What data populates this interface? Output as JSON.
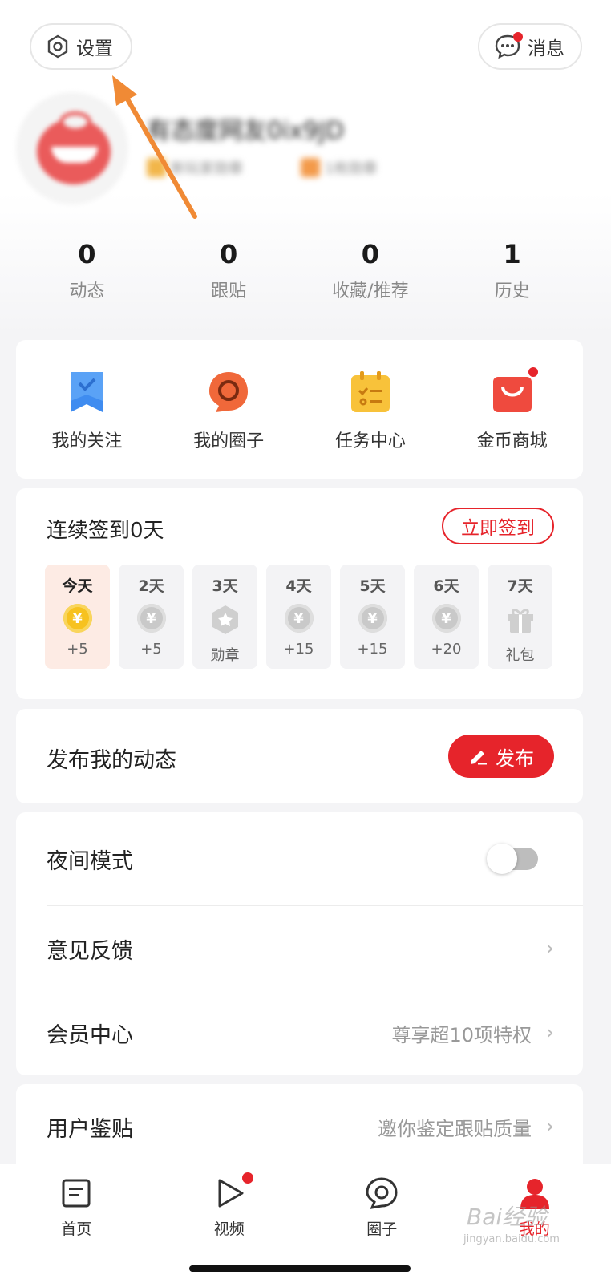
{
  "header": {
    "settings_label": "设置",
    "messages_label": "消息"
  },
  "profile": {
    "username": "有态度网友0ix9JD",
    "badges": [
      "新玩家勋章",
      "1枚勋章"
    ]
  },
  "stats": [
    {
      "value": "0",
      "label": "动态"
    },
    {
      "value": "0",
      "label": "跟贴"
    },
    {
      "value": "0",
      "label": "收藏/推荐"
    },
    {
      "value": "1",
      "label": "历史"
    }
  ],
  "quick_actions": [
    {
      "label": "我的关注",
      "icon": "bookmark-icon"
    },
    {
      "label": "我的圈子",
      "icon": "circle-chat-icon"
    },
    {
      "label": "任务中心",
      "icon": "task-list-icon"
    },
    {
      "label": "金币商城",
      "icon": "shopping-bag-icon"
    }
  ],
  "signin": {
    "title": "连续签到0天",
    "button_label": "立即签到",
    "days": [
      {
        "day": "今天",
        "reward": "+5",
        "icon": "gold-coin-icon"
      },
      {
        "day": "2天",
        "reward": "+5",
        "icon": "coin-icon"
      },
      {
        "day": "3天",
        "reward": "勋章",
        "icon": "medal-icon"
      },
      {
        "day": "4天",
        "reward": "+15",
        "icon": "coin-icon"
      },
      {
        "day": "5天",
        "reward": "+15",
        "icon": "coin-icon"
      },
      {
        "day": "6天",
        "reward": "+20",
        "icon": "coin-icon"
      },
      {
        "day": "7天",
        "reward": "礼包",
        "icon": "gift-icon"
      }
    ]
  },
  "post": {
    "title": "发布我的动态",
    "button_label": "发布"
  },
  "menu": {
    "night_mode": "夜间模式",
    "feedback": "意见反馈",
    "vip_center": "会员中心",
    "vip_hint": "尊享超10项特权",
    "user_review": "用户鉴贴",
    "review_hint": "邀你鉴定跟贴质量"
  },
  "tabbar": [
    {
      "label": "首页"
    },
    {
      "label": "视频"
    },
    {
      "label": "圈子"
    },
    {
      "label": "我的"
    }
  ],
  "watermark": {
    "brand": "Bai经验",
    "url": "jingyan.baidu.com"
  },
  "colors": {
    "accent": "#e6242b",
    "annotation_arrow": "#f08a35"
  }
}
